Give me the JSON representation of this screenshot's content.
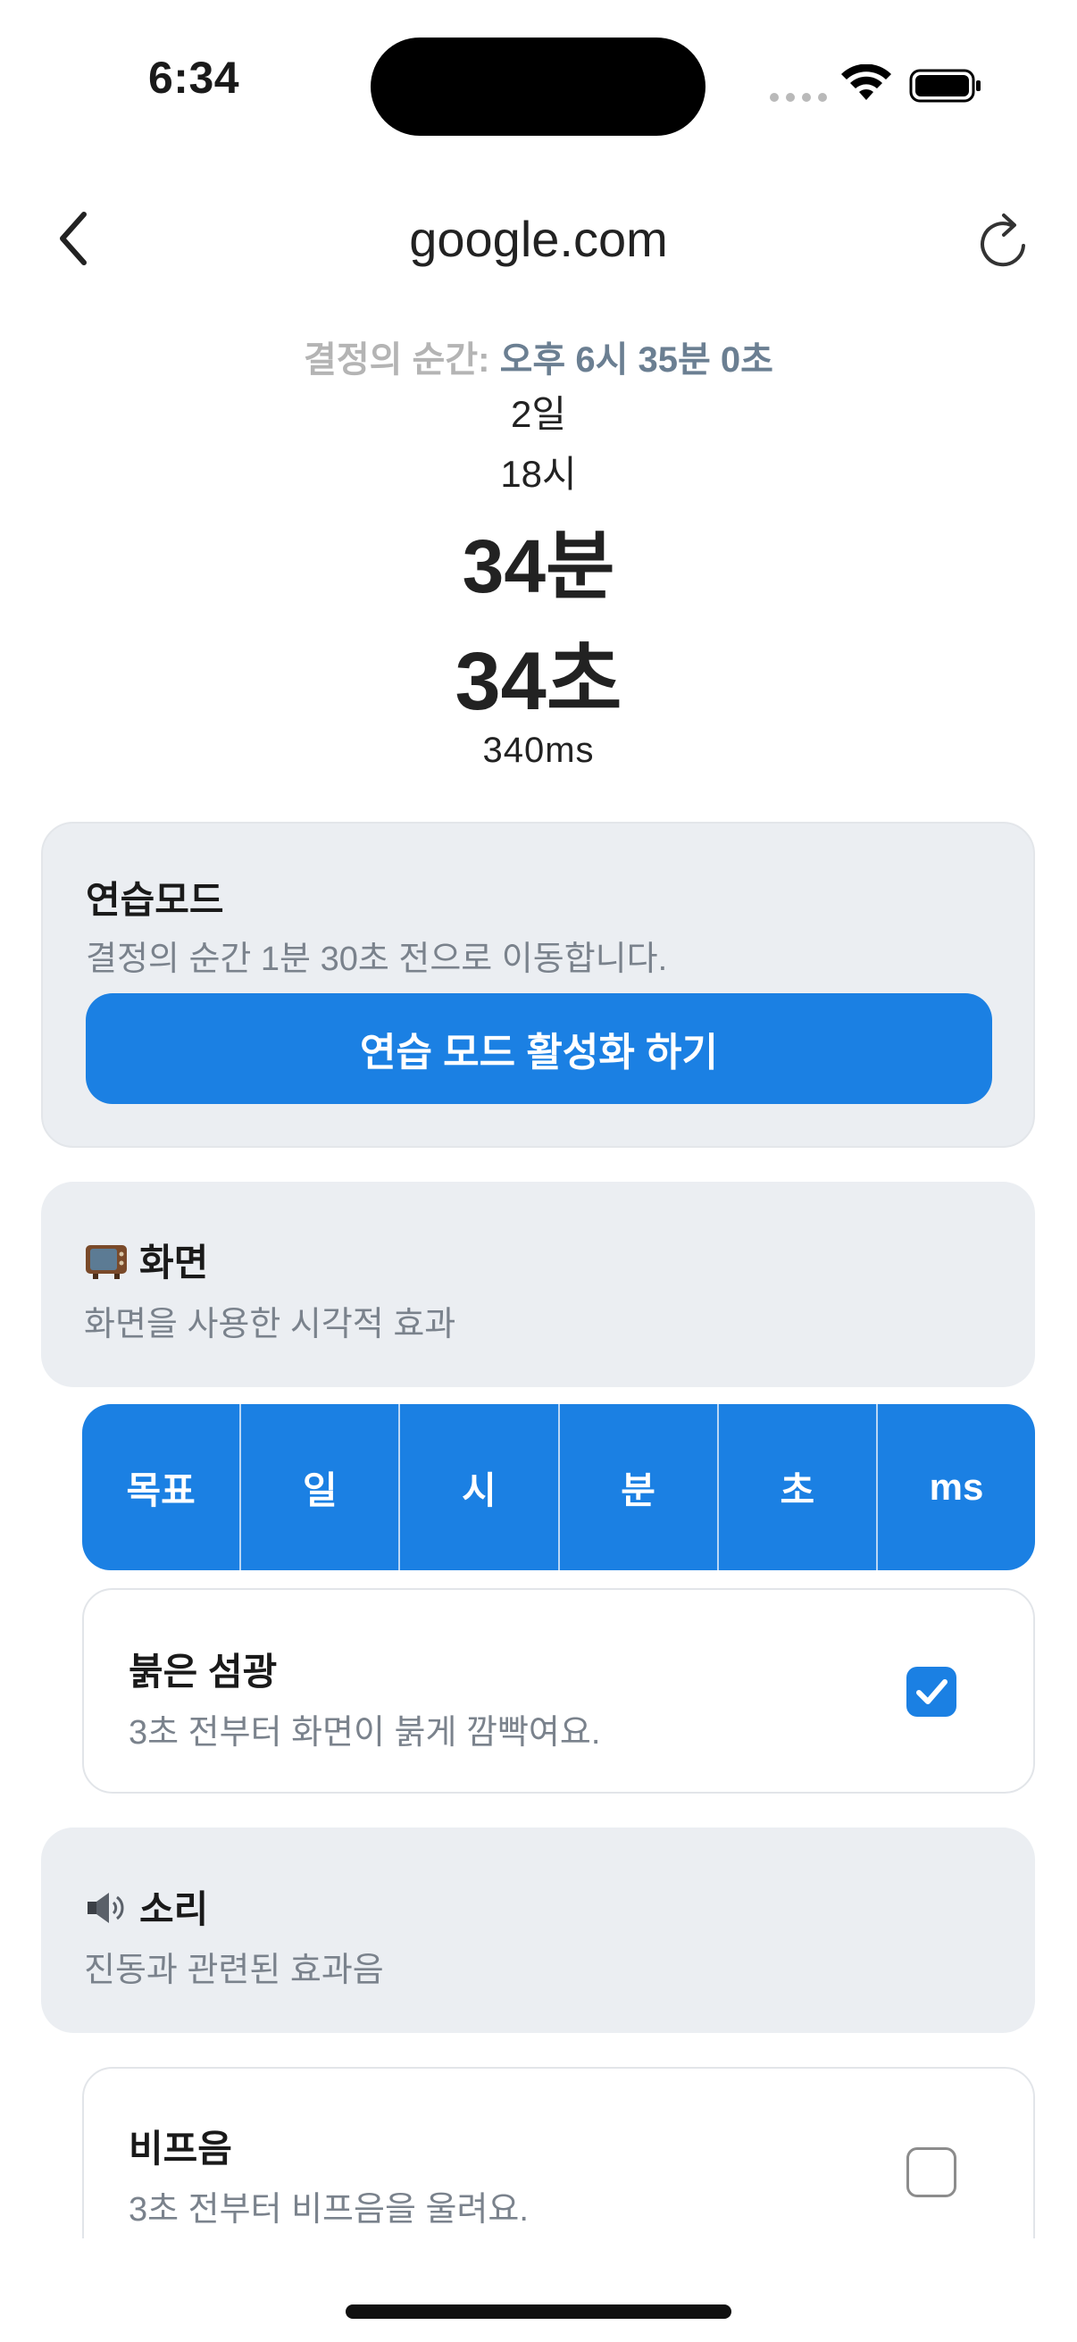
{
  "status_bar": {
    "time": "6:34"
  },
  "nav": {
    "title": "google.com"
  },
  "countdown": {
    "decision_label": "결정의 순간:",
    "decision_value": "오후 6시 35분 0초",
    "days": "2일",
    "hours": "18시",
    "minutes": "34분",
    "seconds": "34초",
    "milliseconds": "340ms"
  },
  "practice": {
    "title": "연습모드",
    "description": "결정의 순간 1분 30초 전으로 이동합니다.",
    "button_label": "연습 모드 활성화 하기"
  },
  "screen_section": {
    "icon": "television-emoji",
    "title": "화면",
    "description": "화면을 사용한 시각적 효과"
  },
  "display_tabs": [
    "목표",
    "일",
    "시",
    "분",
    "초",
    "ms"
  ],
  "red_flash": {
    "title": "붉은 섬광",
    "description": "3초 전부터 화면이 붉게 깜빡여요.",
    "checked": true
  },
  "sound_section": {
    "icon": "speaker-emoji",
    "title": "소리",
    "description": "진동과 관련된 효과음"
  },
  "beep": {
    "title": "비프음",
    "description": "3초 전부터 비프음을 울려요.",
    "checked": false
  },
  "colors": {
    "accent": "#1b80e3",
    "card_bg": "#ebeef2",
    "muted_text": "#7a828c",
    "decision_value": "#6b7f92"
  }
}
